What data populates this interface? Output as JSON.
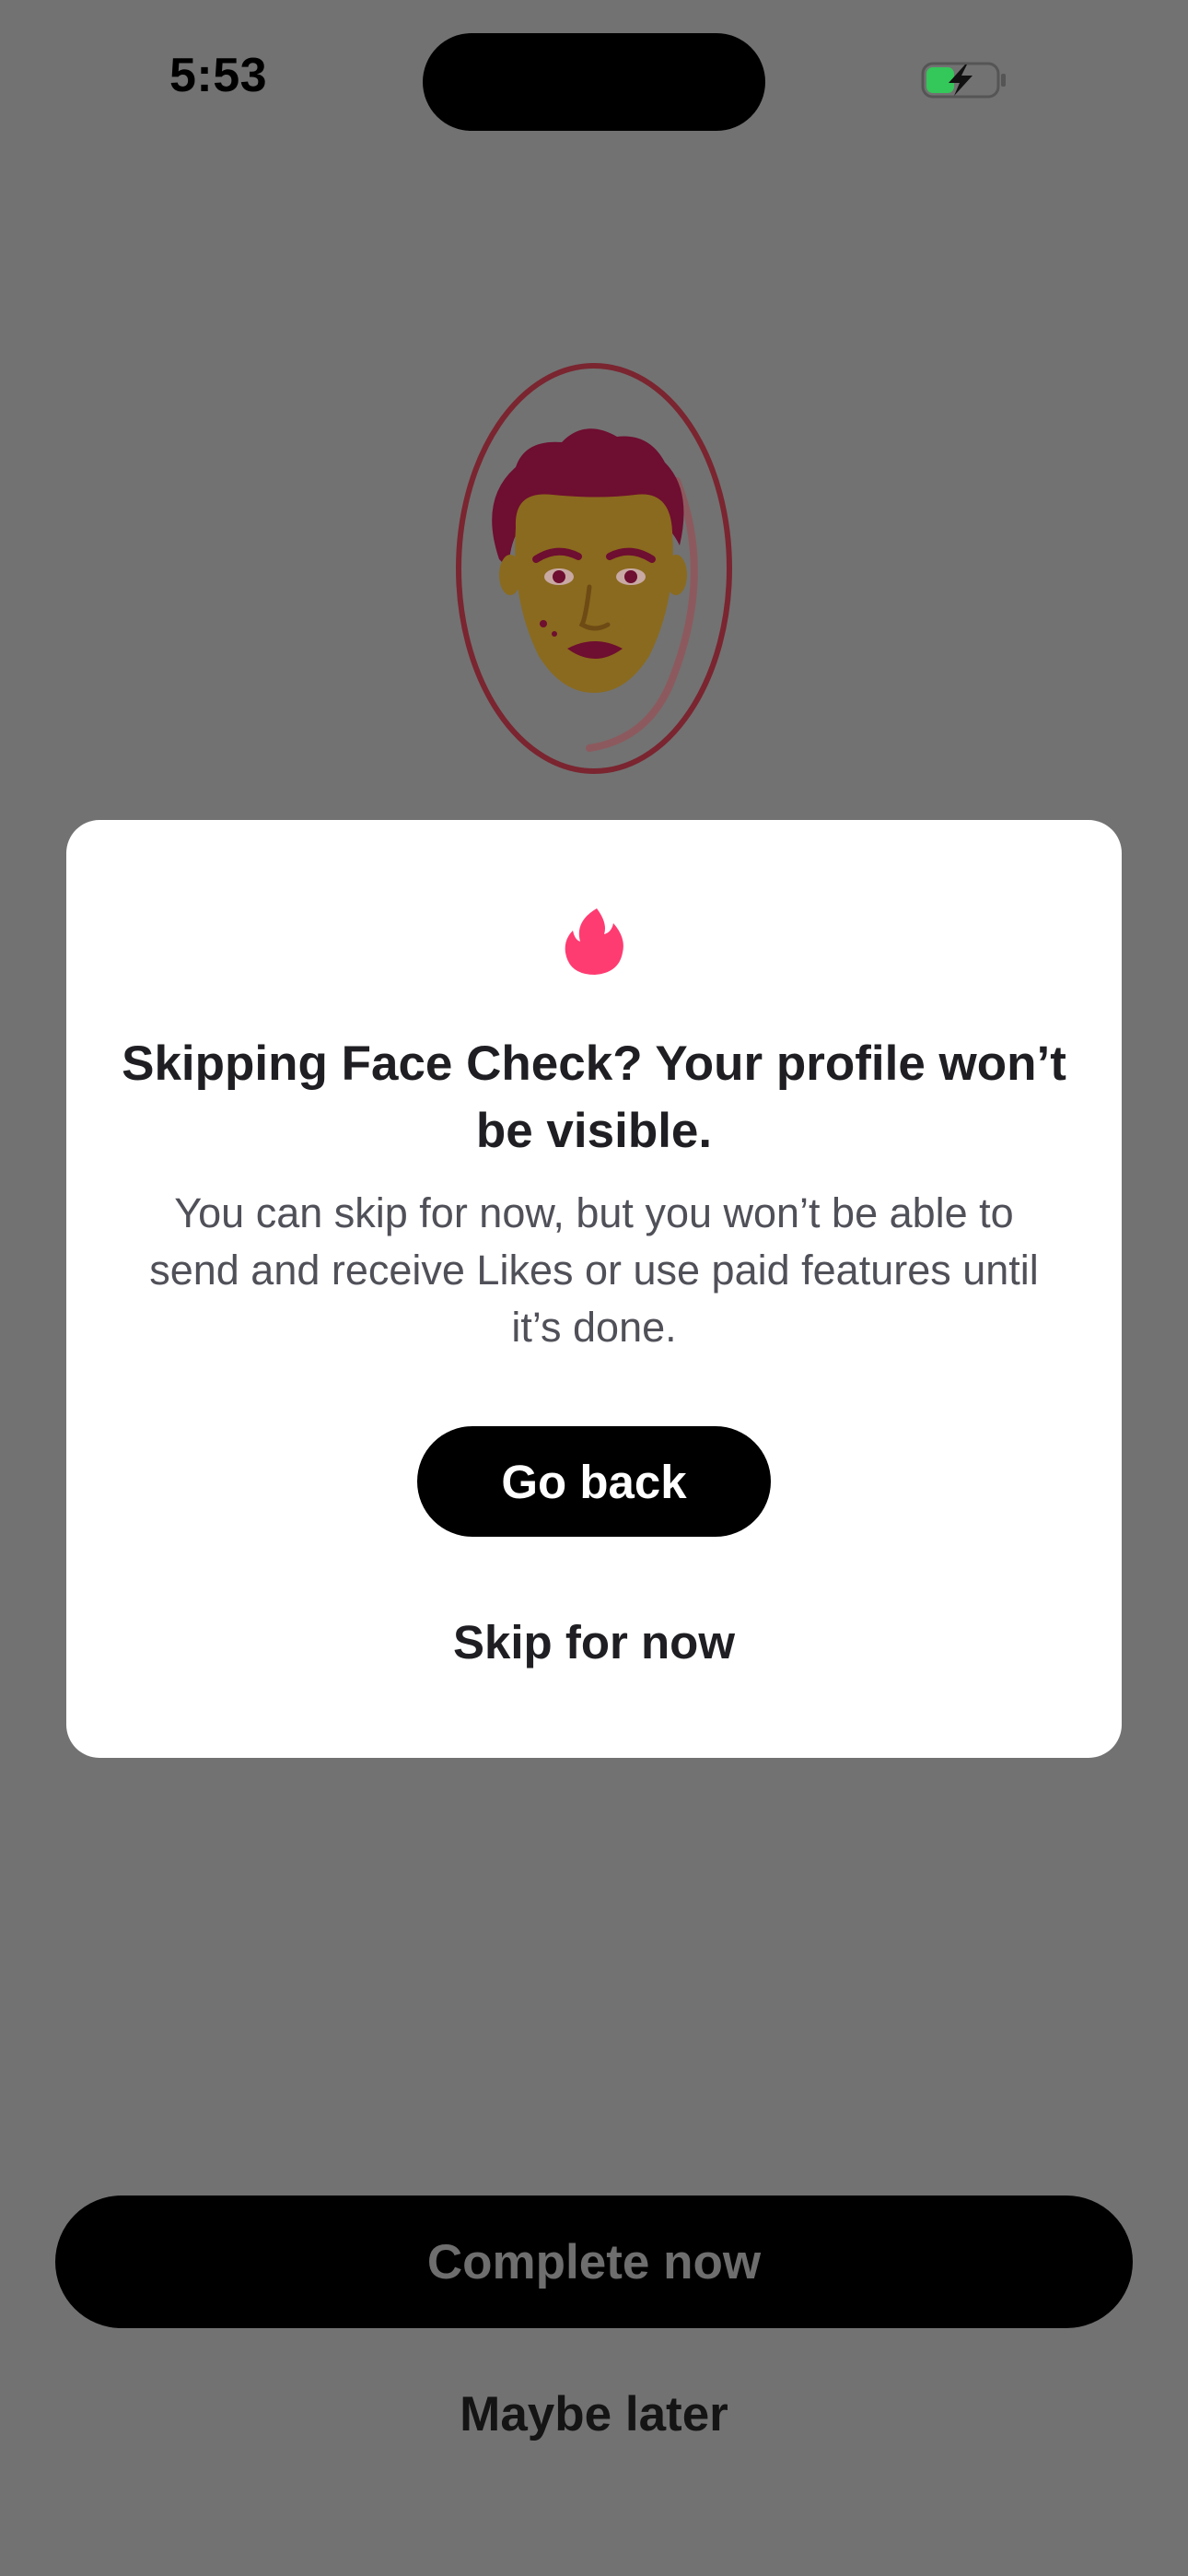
{
  "status_bar": {
    "time": "5:53",
    "battery_state": "charging",
    "battery_icon": "battery-charging-icon"
  },
  "illustration": {
    "icon": "face-check-oval-icon"
  },
  "modal": {
    "icon": "flame-icon",
    "title": "Skipping Face Check? Your profile won’t be visible.",
    "body": "You can skip for now, but you won’t be able to send and receive Likes or use paid features until it’s done.",
    "primary_button": "Go back",
    "secondary_button": "Skip for now"
  },
  "footer": {
    "complete_button": "Complete now",
    "maybe_later": "Maybe later"
  },
  "colors": {
    "overlay_background": "#727272",
    "brand_flame": "#FE3C72",
    "button_black": "#000000"
  }
}
